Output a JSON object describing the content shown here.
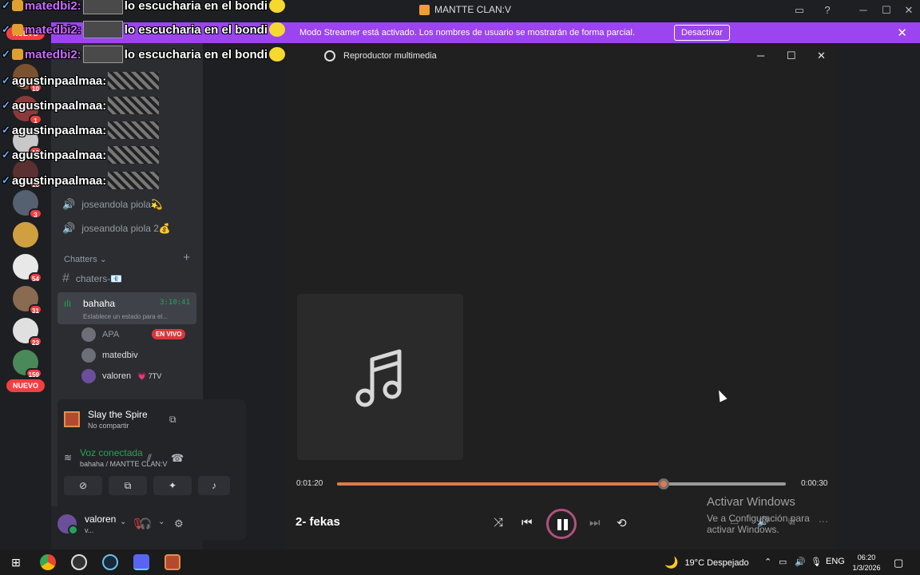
{
  "titlebar": {
    "title": "MANTTE CLAN:V"
  },
  "banner": {
    "text": "Modo Streamer está activado. Los nombres de usuario se mostrarán de forma parcial.",
    "button": "Desactivar",
    "close": "✕"
  },
  "server_rail": {
    "top_pill": "NUEVO",
    "bottom_pill": "NUEVO",
    "badges": [
      "10",
      "1",
      "12",
      "16",
      "3",
      "54",
      "31",
      "23",
      "159"
    ]
  },
  "sidebar": {
    "voice_channels": [
      "joseandola piola💫",
      "joseandola piola 2💰"
    ],
    "category": "Chatters",
    "text_channel": "chaters-📧",
    "active_voice": {
      "name": "bahaha",
      "status": "Establece un estado para el...",
      "timer": "3:10:41",
      "members": [
        {
          "name": "APA",
          "badge": "EN VIVO"
        },
        {
          "name": "matedbiv"
        },
        {
          "name": "valoren",
          "tag": "💗 7TV"
        }
      ]
    }
  },
  "activity": {
    "game_title": "Slay the Spire",
    "game_sub": "No compartir",
    "voice_status": "Voz conectada",
    "voice_channel": "bahaha / MANTTE CLAN:V"
  },
  "user": {
    "name": "valoren",
    "sub": "v..."
  },
  "overlay": [
    {
      "user": "matedbi2:",
      "msg": "lo escucharia en el bondi"
    },
    {
      "user": "matedbi2:",
      "msg": "lo escucharia en el bondi"
    },
    {
      "user": "matedbi2:",
      "msg": "lo escucharia en el bondi"
    },
    {
      "user": "agustinpaalmaa:"
    },
    {
      "user": "agustinpaalmaa:"
    },
    {
      "user": "agustinpaalmaa:"
    },
    {
      "user": "agustinpaalmaa:"
    },
    {
      "user": "agustinpaalmaa:"
    }
  ],
  "player": {
    "title": "Reproductor multimedia",
    "song": "2- fekas",
    "elapsed": "0:01:20",
    "remaining": "0:00:30",
    "progress": 0.727
  },
  "watermark": {
    "line1": "Activar Windows",
    "line2": "Ve a Configuración para activar Windows."
  },
  "taskbar": {
    "weather": "19°C  Despejado",
    "lang": "ENG",
    "time": "06:20",
    "date": "1/3/2026"
  }
}
